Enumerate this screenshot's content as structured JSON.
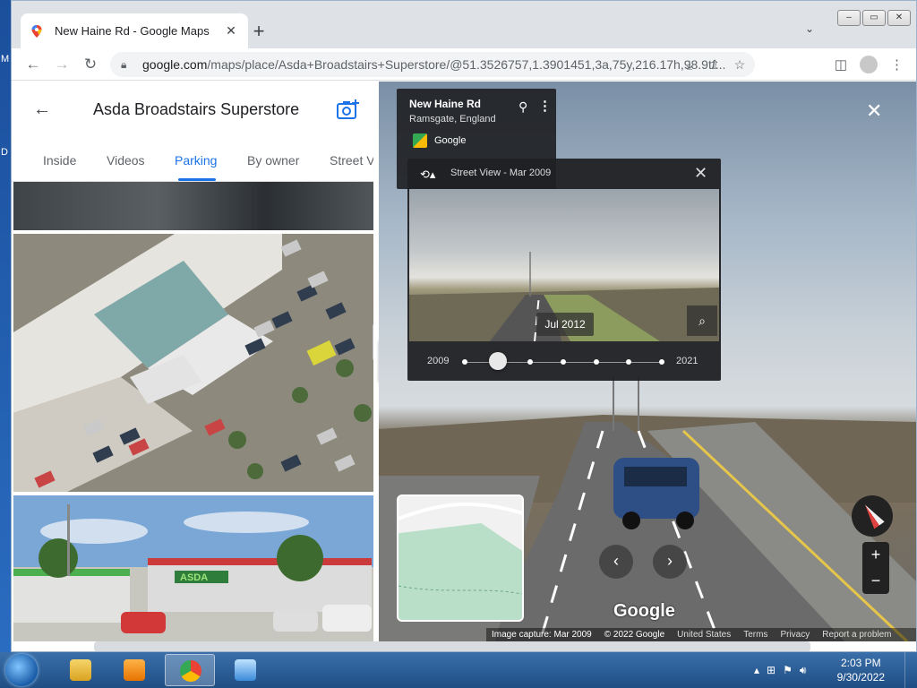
{
  "desktop": {
    "left_chars": [
      "M",
      "D"
    ]
  },
  "browser": {
    "tab_title": "New Haine Rd - Google Maps",
    "url_host": "google.com",
    "url_path": "/maps/place/Asda+Broadstairs+Superstore/@51.3526757,1.3901451,3a,75y,216.17h,98.9t/...",
    "window_controls": [
      "‒",
      "▭",
      "✕"
    ]
  },
  "left_panel": {
    "title": "Asda Broadstairs Superstore",
    "tabs": [
      {
        "label": "Inside"
      },
      {
        "label": "Videos"
      },
      {
        "label": "Parking"
      },
      {
        "label": "By owner"
      },
      {
        "label": "Street Vi"
      }
    ],
    "active_tab": "Parking",
    "store_sign": "ASDA"
  },
  "street_view": {
    "road_name": "New Haine Rd",
    "place": "Ramsgate, England",
    "provider": "Google",
    "time_machine": {
      "title": "Street View - Mar 2009",
      "selected_date": "Jul 2012",
      "start_year": "2009",
      "end_year": "2021",
      "tick_count": 7,
      "selected_index": 1
    },
    "watermark": "Google",
    "footer": {
      "capture": "Image capture: Mar 2009",
      "copyright": "© 2022 Google",
      "country": "United States",
      "terms": "Terms",
      "privacy": "Privacy",
      "report": "Report a problem"
    }
  },
  "taskbar": {
    "time": "2:03 PM",
    "date": "9/30/2022"
  }
}
